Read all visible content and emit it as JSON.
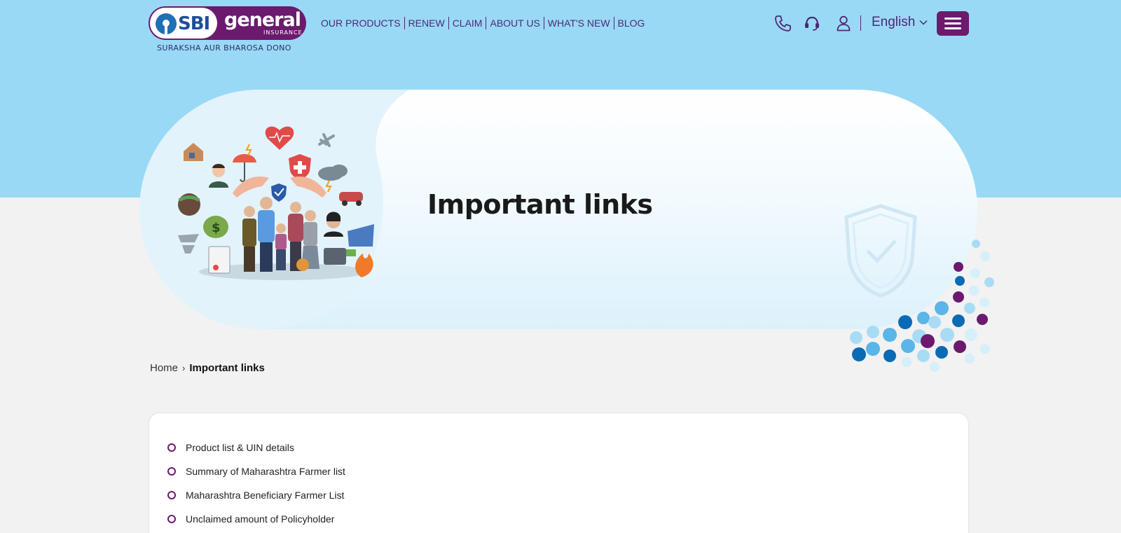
{
  "brand": {
    "name_left": "SBI",
    "name_right": "general",
    "sub": "INSURANCE",
    "tagline": "SURAKSHA AUR BHAROSA DONO",
    "primary_color": "#6b1a6e",
    "sky_color": "#9ad9f5"
  },
  "nav": {
    "items": [
      "OUR PRODUCTS",
      "RENEW",
      "CLAIM",
      "ABOUT US",
      "WHAT'S NEW",
      "BLOG"
    ]
  },
  "header": {
    "icons": [
      "phone-icon",
      "headset-icon",
      "user-icon"
    ],
    "language": "English"
  },
  "hero": {
    "title": "Important links"
  },
  "breadcrumb": {
    "home": "Home",
    "separator": "›",
    "current": "Important links"
  },
  "links": [
    "Product list & UIN details",
    "Summary of Maharashtra Farmer list",
    "Maharashtra Beneficiary Farmer List",
    "Unclaimed amount of Policyholder"
  ]
}
